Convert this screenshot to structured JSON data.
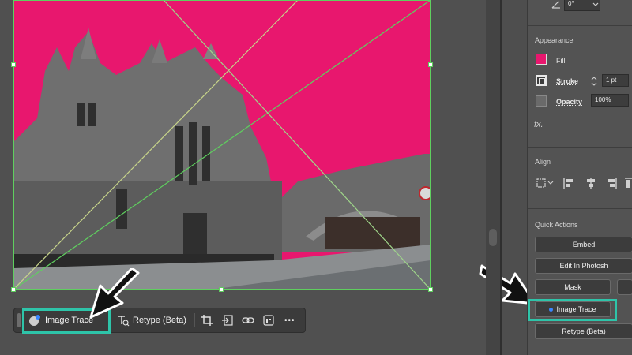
{
  "panel": {
    "angle_value": "0°",
    "appearance": {
      "title": "Appearance",
      "fill_label": "Fill",
      "fill_color": "#e8176e",
      "stroke_label": "Stroke",
      "stroke_value": "1 pt",
      "opacity_label": "Opacity",
      "opacity_value": "100%",
      "fx_label": "fx."
    },
    "align": {
      "title": "Align"
    },
    "quick_actions": {
      "title": "Quick Actions",
      "embed": "Embed",
      "edit_in_photoshop": "Edit In Photosh",
      "mask": "Mask",
      "image_trace": "Image Trace",
      "retype": "Retype (Beta)"
    }
  },
  "toolbar": {
    "image_trace": "Image Trace",
    "retype": "Retype (Beta)",
    "more": "•••"
  },
  "colors": {
    "sky": "#e8176e",
    "highlight": "#2ec4a9",
    "selection": "#5fcf5f"
  }
}
